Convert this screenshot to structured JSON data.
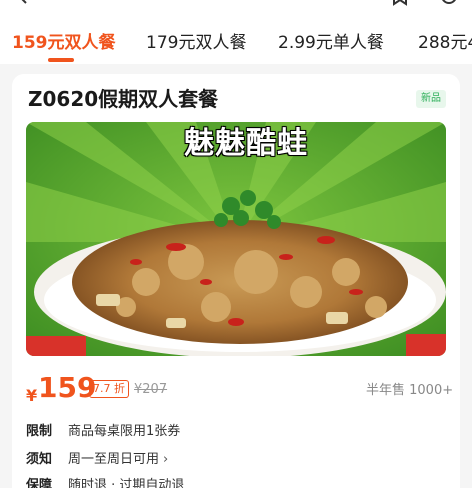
{
  "tabs": [
    {
      "label": "159元双人餐"
    },
    {
      "label": "179元双人餐"
    },
    {
      "label": "2.99元单人餐"
    },
    {
      "label": "288元4"
    }
  ],
  "deal": {
    "title": "Z0620假期双人套餐",
    "badge": "新品",
    "hero_text": "魅魅酷蛙",
    "currency": "¥",
    "price": "159",
    "discount": "7.7 折",
    "original_price": "¥207",
    "sales": "半年售 1000+"
  },
  "info": [
    {
      "label": "限制",
      "value": "商品每桌限用1张券"
    },
    {
      "label": "须知",
      "value": "周一至周日可用"
    },
    {
      "label": "保障",
      "value": "随时退 · 过期自动退"
    }
  ],
  "colors": {
    "accent": "#f0541d",
    "badge_green": "#2bae58",
    "hero_green": "#58a42c"
  },
  "icons": [
    "back-arrow-icon",
    "favorite-icon",
    "more-icon",
    "chevron-right-icon"
  ]
}
